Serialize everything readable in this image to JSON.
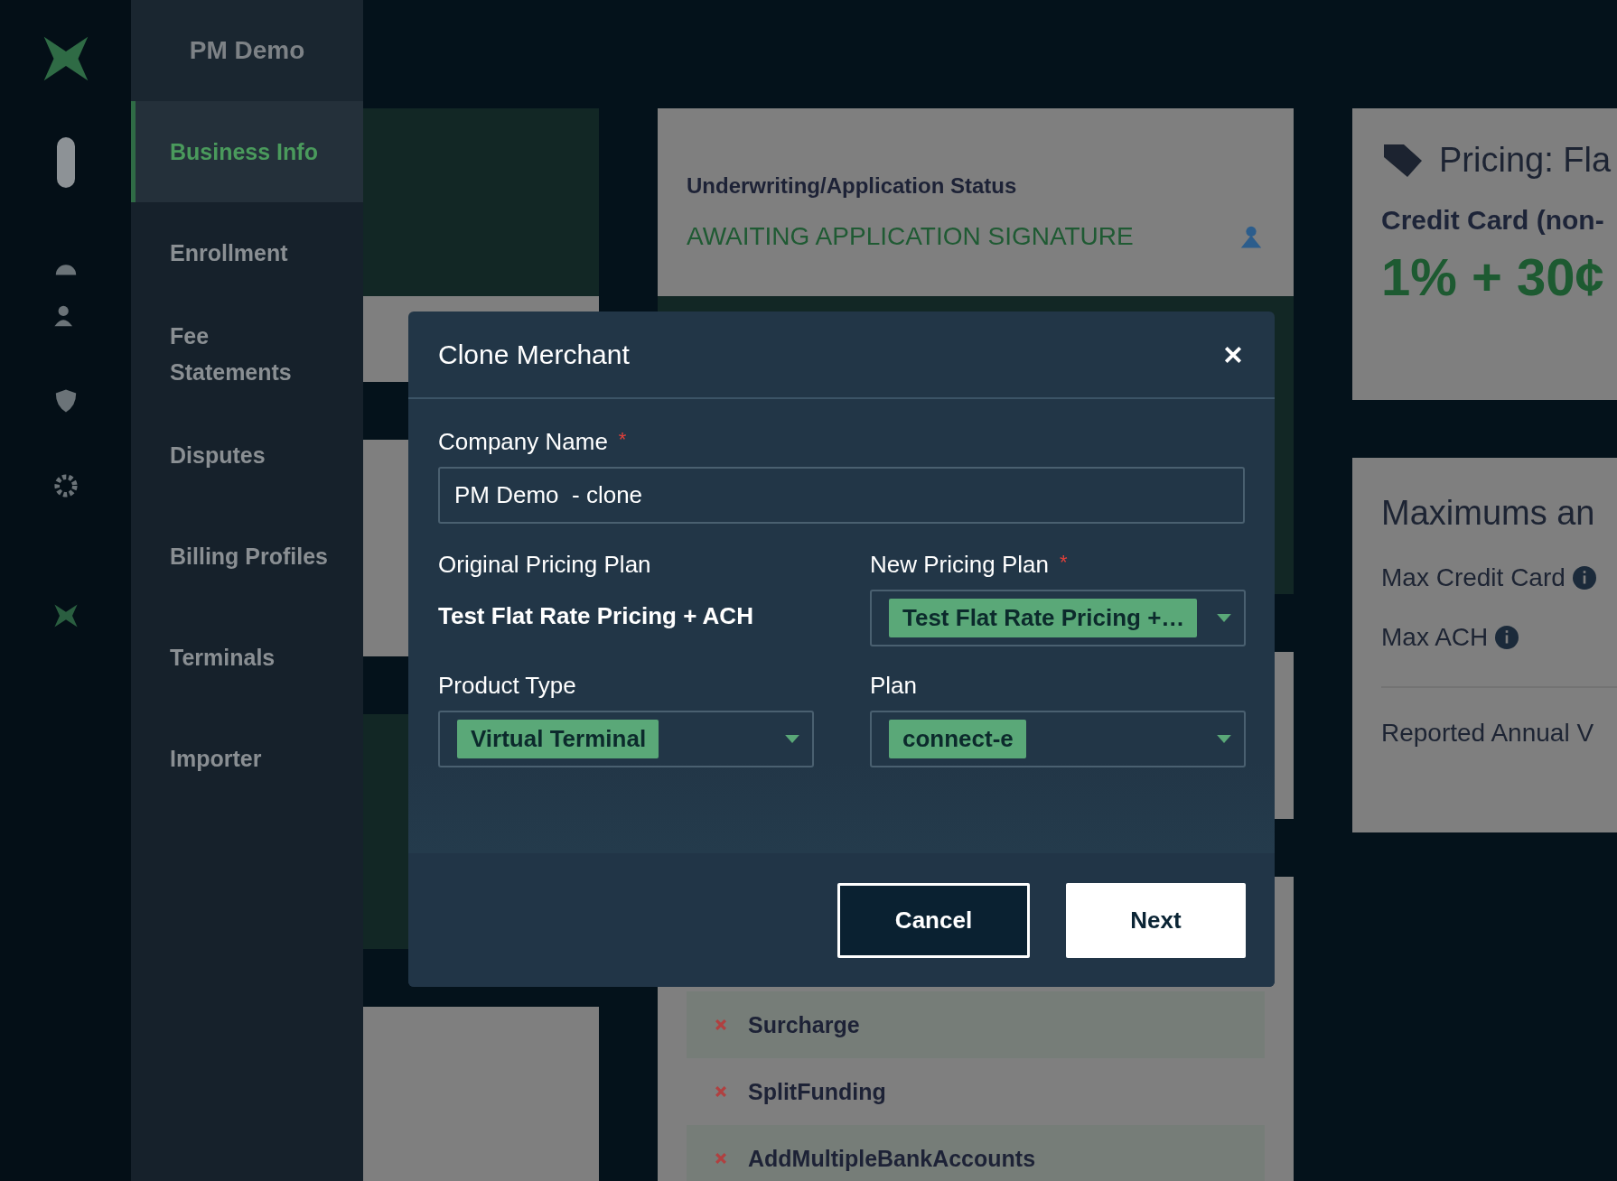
{
  "sidebar": {
    "title": "PM Demo",
    "items": [
      {
        "label": "Business Info",
        "selected": true
      },
      {
        "label": "Enrollment",
        "selected": false
      },
      {
        "label": "Fee Statements",
        "selected": false
      },
      {
        "label": "Disputes",
        "selected": false
      },
      {
        "label": "Billing Profiles",
        "selected": false
      },
      {
        "label": "Terminals",
        "selected": false
      },
      {
        "label": "Importer",
        "selected": false
      }
    ]
  },
  "status_card": {
    "label": "Underwriting/Application Status",
    "status": "AWAITING APPLICATION SIGNATURE"
  },
  "features": [
    "Surcharge",
    "SplitFunding",
    "AddMultipleBankAccounts"
  ],
  "pricing_card": {
    "title": "Pricing: Fla",
    "subtitle": "Credit Card (non-",
    "rate": "1% + 30¢"
  },
  "limits_card": {
    "title": "Maximums an",
    "rows": [
      "Max Credit Card",
      "Max ACH"
    ],
    "footer": "Reported Annual V"
  },
  "modal": {
    "title": "Clone Merchant",
    "company_name": {
      "label": "Company Name",
      "required_mark": "*",
      "value": "PM Demo  - clone"
    },
    "original_plan": {
      "label": "Original Pricing Plan",
      "value": "Test Flat Rate Pricing + ACH"
    },
    "new_plan": {
      "label": "New Pricing Plan",
      "required_mark": "*",
      "value": "Test Flat Rate Pricing +…"
    },
    "product_type": {
      "label": "Product Type",
      "value": "Virtual Terminal"
    },
    "plan": {
      "label": "Plan",
      "value": "connect-e"
    },
    "buttons": [
      {
        "label": "Cancel",
        "kind": "secondary"
      },
      {
        "label": "Next",
        "kind": "primary"
      }
    ]
  }
}
